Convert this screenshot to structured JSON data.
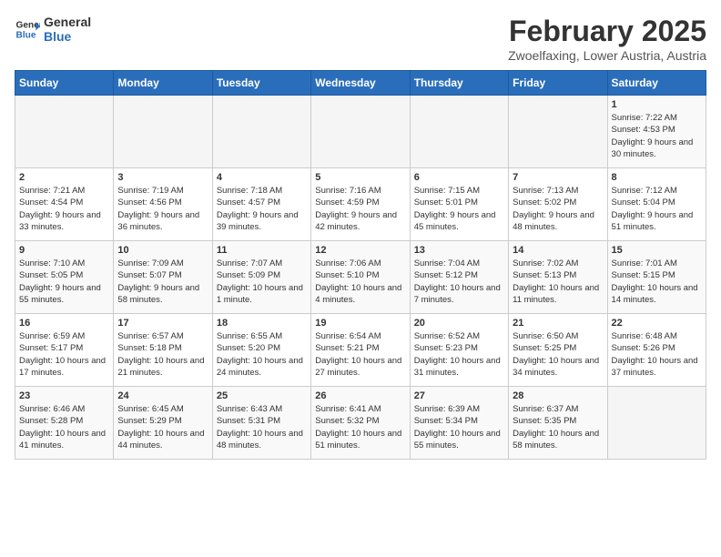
{
  "header": {
    "logo_line1": "General",
    "logo_line2": "Blue",
    "month": "February 2025",
    "location": "Zwoelfaxing, Lower Austria, Austria"
  },
  "days_of_week": [
    "Sunday",
    "Monday",
    "Tuesday",
    "Wednesday",
    "Thursday",
    "Friday",
    "Saturday"
  ],
  "weeks": [
    [
      {
        "day": "",
        "info": ""
      },
      {
        "day": "",
        "info": ""
      },
      {
        "day": "",
        "info": ""
      },
      {
        "day": "",
        "info": ""
      },
      {
        "day": "",
        "info": ""
      },
      {
        "day": "",
        "info": ""
      },
      {
        "day": "1",
        "info": "Sunrise: 7:22 AM\nSunset: 4:53 PM\nDaylight: 9 hours and 30 minutes."
      }
    ],
    [
      {
        "day": "2",
        "info": "Sunrise: 7:21 AM\nSunset: 4:54 PM\nDaylight: 9 hours and 33 minutes."
      },
      {
        "day": "3",
        "info": "Sunrise: 7:19 AM\nSunset: 4:56 PM\nDaylight: 9 hours and 36 minutes."
      },
      {
        "day": "4",
        "info": "Sunrise: 7:18 AM\nSunset: 4:57 PM\nDaylight: 9 hours and 39 minutes."
      },
      {
        "day": "5",
        "info": "Sunrise: 7:16 AM\nSunset: 4:59 PM\nDaylight: 9 hours and 42 minutes."
      },
      {
        "day": "6",
        "info": "Sunrise: 7:15 AM\nSunset: 5:01 PM\nDaylight: 9 hours and 45 minutes."
      },
      {
        "day": "7",
        "info": "Sunrise: 7:13 AM\nSunset: 5:02 PM\nDaylight: 9 hours and 48 minutes."
      },
      {
        "day": "8",
        "info": "Sunrise: 7:12 AM\nSunset: 5:04 PM\nDaylight: 9 hours and 51 minutes."
      }
    ],
    [
      {
        "day": "9",
        "info": "Sunrise: 7:10 AM\nSunset: 5:05 PM\nDaylight: 9 hours and 55 minutes."
      },
      {
        "day": "10",
        "info": "Sunrise: 7:09 AM\nSunset: 5:07 PM\nDaylight: 9 hours and 58 minutes."
      },
      {
        "day": "11",
        "info": "Sunrise: 7:07 AM\nSunset: 5:09 PM\nDaylight: 10 hours and 1 minute."
      },
      {
        "day": "12",
        "info": "Sunrise: 7:06 AM\nSunset: 5:10 PM\nDaylight: 10 hours and 4 minutes."
      },
      {
        "day": "13",
        "info": "Sunrise: 7:04 AM\nSunset: 5:12 PM\nDaylight: 10 hours and 7 minutes."
      },
      {
        "day": "14",
        "info": "Sunrise: 7:02 AM\nSunset: 5:13 PM\nDaylight: 10 hours and 11 minutes."
      },
      {
        "day": "15",
        "info": "Sunrise: 7:01 AM\nSunset: 5:15 PM\nDaylight: 10 hours and 14 minutes."
      }
    ],
    [
      {
        "day": "16",
        "info": "Sunrise: 6:59 AM\nSunset: 5:17 PM\nDaylight: 10 hours and 17 minutes."
      },
      {
        "day": "17",
        "info": "Sunrise: 6:57 AM\nSunset: 5:18 PM\nDaylight: 10 hours and 21 minutes."
      },
      {
        "day": "18",
        "info": "Sunrise: 6:55 AM\nSunset: 5:20 PM\nDaylight: 10 hours and 24 minutes."
      },
      {
        "day": "19",
        "info": "Sunrise: 6:54 AM\nSunset: 5:21 PM\nDaylight: 10 hours and 27 minutes."
      },
      {
        "day": "20",
        "info": "Sunrise: 6:52 AM\nSunset: 5:23 PM\nDaylight: 10 hours and 31 minutes."
      },
      {
        "day": "21",
        "info": "Sunrise: 6:50 AM\nSunset: 5:25 PM\nDaylight: 10 hours and 34 minutes."
      },
      {
        "day": "22",
        "info": "Sunrise: 6:48 AM\nSunset: 5:26 PM\nDaylight: 10 hours and 37 minutes."
      }
    ],
    [
      {
        "day": "23",
        "info": "Sunrise: 6:46 AM\nSunset: 5:28 PM\nDaylight: 10 hours and 41 minutes."
      },
      {
        "day": "24",
        "info": "Sunrise: 6:45 AM\nSunset: 5:29 PM\nDaylight: 10 hours and 44 minutes."
      },
      {
        "day": "25",
        "info": "Sunrise: 6:43 AM\nSunset: 5:31 PM\nDaylight: 10 hours and 48 minutes."
      },
      {
        "day": "26",
        "info": "Sunrise: 6:41 AM\nSunset: 5:32 PM\nDaylight: 10 hours and 51 minutes."
      },
      {
        "day": "27",
        "info": "Sunrise: 6:39 AM\nSunset: 5:34 PM\nDaylight: 10 hours and 55 minutes."
      },
      {
        "day": "28",
        "info": "Sunrise: 6:37 AM\nSunset: 5:35 PM\nDaylight: 10 hours and 58 minutes."
      },
      {
        "day": "",
        "info": ""
      }
    ]
  ]
}
